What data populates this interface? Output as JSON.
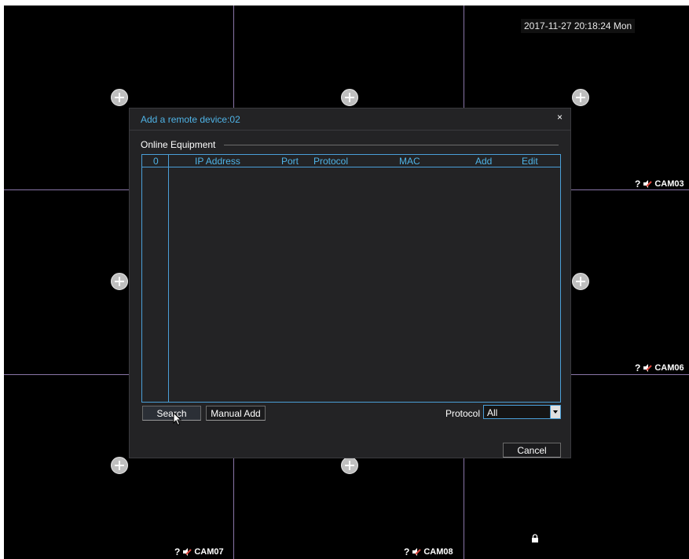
{
  "datetime": "2017-11-27 20:18:24 Mon",
  "cameras": {
    "cam03_label": "CAM03",
    "cam06_label": "CAM06",
    "cam07_label": "CAM07",
    "cam08_label": "CAM08",
    "unknown_symbol": "?"
  },
  "dialog": {
    "title": "Add a remote device:02",
    "close_symbol": "×",
    "group_label": "Online Equipment",
    "table": {
      "columns": [
        "0",
        "IP Address",
        "Port",
        "Protocol",
        "MAC",
        "Add",
        "Edit"
      ],
      "rows": []
    },
    "search_label": "Search",
    "manual_add_label": "Manual Add",
    "protocol_label": "Protocol",
    "protocol_value": "All",
    "cancel_label": "Cancel"
  },
  "colors": {
    "accent": "#4fb3e6",
    "grid_line": "#8a76a8",
    "dialog_bg": "#232325",
    "speaker_red": "#e0493f"
  },
  "icons": {
    "add_camera": "plus-circle-icon",
    "speaker": "speaker-muted-icon",
    "lock": "lock-icon",
    "close": "close-icon",
    "cursor": "mouse-pointer-icon"
  }
}
